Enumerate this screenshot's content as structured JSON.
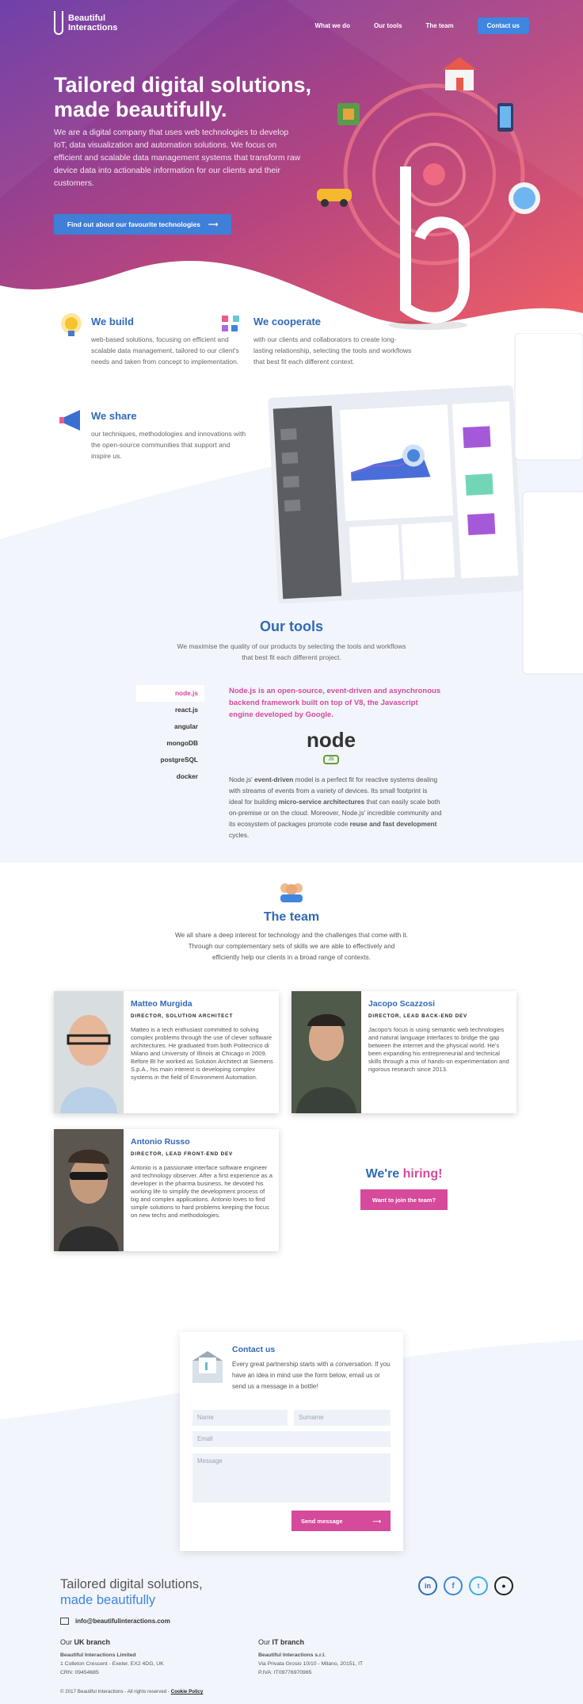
{
  "colors": {
    "brand_blue": "#2f6ab8",
    "accent_pink": "#d54a9b",
    "button_blue": "#3f7fd8",
    "hero_gradient_start": "#7b3fa3",
    "hero_gradient_end": "#e85a6a"
  },
  "nav": {
    "logo_line1": "Beautiful",
    "logo_line2": "Interactions",
    "items": [
      "What we do",
      "Our tools",
      "The team"
    ],
    "contact": "Contact us"
  },
  "hero": {
    "title": "Tailored digital solutions, made beautifully.",
    "description": "We are a digital company that uses web technologies to develop IoT, data visualization and automation solutions. We focus on efficient and scalable data management systems that transform raw device data into actionable information for our clients and their customers.",
    "cta": "Find out about our favourite technologies"
  },
  "features": [
    {
      "title": "We build",
      "text": "web-based solutions, focusing on efficient and scalable data management, tailored to our client's needs and taken from concept to implementation.",
      "icon": "lightbulb-icon"
    },
    {
      "title": "We cooperate",
      "text": "with our clients and collaborators to create long-lasting relationship, selecting the tools and workflows that best fit each different context.",
      "icon": "blocks-icon"
    },
    {
      "title": "We share",
      "text": "our techniques, methodologies and innovations with the open-source communities that support and inspire us.",
      "icon": "megaphone-icon"
    }
  ],
  "tools": {
    "title": "Our tools",
    "subtitle": "We maximise the quality of our products by selecting the tools and workflows that best fit each different project.",
    "list": [
      "node.js",
      "react.js",
      "angular",
      "mongoDB",
      "postgreSQL",
      "docker"
    ],
    "active": "node.js",
    "headline": "Node.js is an open-source, event-driven and asynchronous backend framework built on top of V8, the Javascript engine developed by Google.",
    "logo_text": "node",
    "logo_badge": "JS",
    "body_1": "Node.js' ",
    "body_b1": "event-driven",
    "body_2": " model is a perfect fit for reactive systems dealing with streams of events from a variety of devices. Its small footprint is ideal for building ",
    "body_b2": "micro-service architectures",
    "body_3": " that can easily scale both on-premise or on the cloud. Moreover, Node.js' incredible community and its ecosystem of packages promote code ",
    "body_b3": "reuse and fast development",
    "body_4": " cycles."
  },
  "team": {
    "title": "The team",
    "subtitle": "We all share a deep interest for technology and the challenges that come with it. Through our complementary sets of skills we are able to effectively and efficiently help our clients in a broad range of contexts.",
    "members": [
      {
        "name": "Matteo Murgida",
        "role": "DIRECTOR, SOLUTION ARCHITECT",
        "bio": "Matteo is a tech enthusiast committed to solving complex problems through the use of clever software architectures. He graduated from both Politecnico di Milano and University of Illinois at Chicago in 2009. Before BI he worked as Solution Architect at Siemens S.p.A., his main interest is developing complex systems in the field of Environment Automation."
      },
      {
        "name": "Jacopo Scazzosi",
        "role": "DIRECTOR, LEAD BACK-END DEV",
        "bio": "Jacopo's focus is using semantic web technologies and natural language interfaces to bridge the gap between the internet and the physical world. He's been expanding his entrepreneurial and technical skills through a mix of hands-on experimentation and rigorous research since 2013."
      },
      {
        "name": "Antonio Russo",
        "role": "DIRECTOR, LEAD FRONT-END DEV",
        "bio": "Antonio is a passionate interface software engineer and technology observer. After a first experience as a developer in the pharma business, he devoted his working life to simplify the development process of big and complex applications. Antonio loves to find simple solutions to hard problems keeping the focus on new techs and methodologies."
      }
    ],
    "hiring_title_1": "We're ",
    "hiring_title_2": "hiring!",
    "hiring_cta": "Want to join the team?"
  },
  "contact": {
    "title": "Contact us",
    "text": "Every great partnership starts with a conversation. If you have an idea in mind use the form below, email us or send us a message in a bottle!",
    "name_ph": "Name",
    "surname_ph": "Surname",
    "email_ph": "Email",
    "message_ph": "Message",
    "send": "Send message"
  },
  "footer": {
    "title_1": "Tailored digital solutions,",
    "title_2": "made beautifully",
    "email": "info@beautifulinteractions.com",
    "uk_label": "Our ",
    "uk_strong": "UK branch",
    "uk_company": "Beautiful Interactions Limited",
    "uk_address": "1 Colleton Crescent - Exeter, EX2 4DG, UK",
    "uk_crn": "CRN: 09454685",
    "it_label": "Our ",
    "it_strong": "IT branch",
    "it_company": "Beautiful Interactions s.r.l.",
    "it_address": "Via Privata Grosio 10/10 - Milano, 20151, IT",
    "it_vat": "P.IVA: IT09776970965",
    "copyright": "© 2017 Beautiful Interactions - All rights reserved - ",
    "cookie": "Cookie Policy",
    "social": [
      "linkedin-icon",
      "facebook-icon",
      "twitter-icon",
      "github-icon"
    ]
  }
}
